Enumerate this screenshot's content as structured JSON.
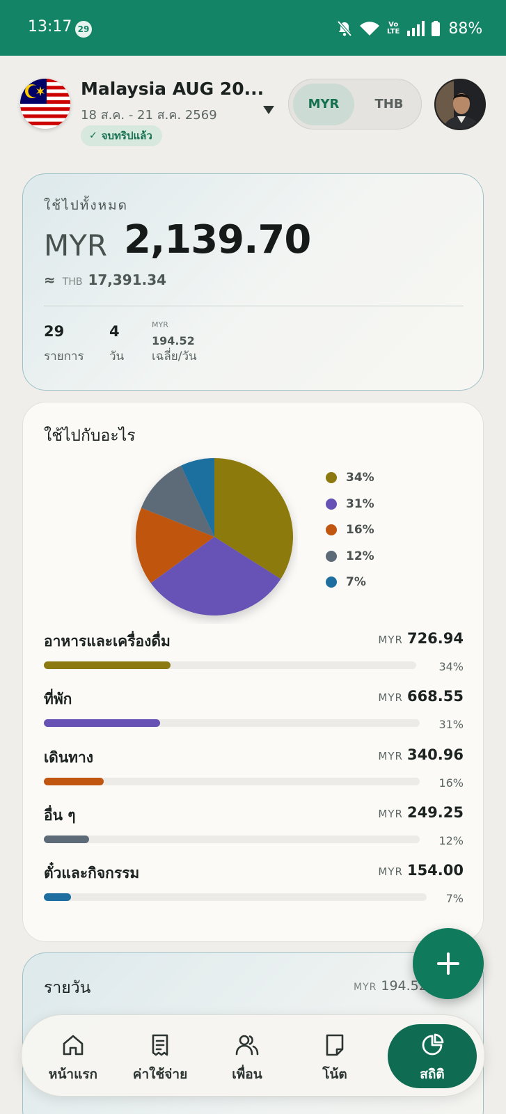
{
  "status_bar": {
    "time": "13:17",
    "badge": "29",
    "volte_top": "Vo",
    "volte_bottom": "LTE",
    "battery": "88%"
  },
  "header": {
    "title": "Malaysia AUG 20...",
    "dates": "18 ส.ค. - 21 ส.ค. 2569",
    "status": "จบทริปแล้ว",
    "currency_options": [
      "MYR",
      "THB"
    ],
    "selected_currency": "MYR"
  },
  "total": {
    "label": "ใช้ไปทั้งหมด",
    "currency": "MYR",
    "amount": "2,139.70",
    "approx_symbol": "≈",
    "approx_currency": "THB",
    "approx_amount": "17,391.34",
    "items_count": "29",
    "items_label": "รายการ",
    "days_count": "4",
    "days_label": "วัน",
    "avg_currency": "MYR",
    "avg_amount": "194.52",
    "avg_label": "เฉลี่ย/วัน"
  },
  "categories": {
    "title": "ใช้ไปกับอะไร",
    "colors": [
      "#8c7a10",
      "#6652b5",
      "#c0560f",
      "#5d6a78",
      "#1e6f9f"
    ],
    "currency": "MYR",
    "items": [
      {
        "name": "อาหารและเครื่องดื่ม",
        "amount": "726.94",
        "pct_label": "34%",
        "share": 0.34
      },
      {
        "name": "ที่พัก",
        "amount": "668.55",
        "pct_label": "31%",
        "share": 0.31
      },
      {
        "name": "เดินทาง",
        "amount": "340.96",
        "pct_label": "16%",
        "share": 0.16
      },
      {
        "name": "อื่น ๆ",
        "amount": "249.25",
        "pct_label": "12%",
        "share": 0.12
      },
      {
        "name": "ตั๋วและกิจกรรม",
        "amount": "154.00",
        "pct_label": "7%",
        "share": 0.07
      }
    ]
  },
  "daily": {
    "title": "รายวัน",
    "currency": "MYR",
    "avg": "194.52"
  },
  "nav": {
    "items": [
      {
        "label": "หน้าแรก",
        "icon": "home-icon"
      },
      {
        "label": "ค่าใช้จ่าย",
        "icon": "receipt-icon"
      },
      {
        "label": "เพื่อน",
        "icon": "users-icon"
      },
      {
        "label": "โน้ต",
        "icon": "note-icon"
      },
      {
        "label": "สถิติ",
        "icon": "pie-chart-icon"
      }
    ],
    "active": "สถิติ"
  },
  "fab": {
    "icon": "plus-icon"
  }
}
